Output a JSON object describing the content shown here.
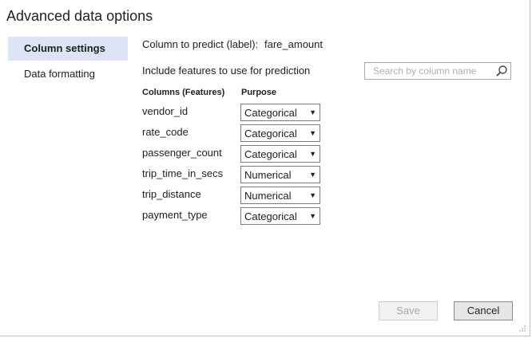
{
  "dialog": {
    "title": "Advanced data options"
  },
  "sidebar": {
    "items": [
      {
        "label": "Column settings",
        "active": true
      },
      {
        "label": "Data formatting",
        "active": false
      }
    ]
  },
  "main": {
    "predict_label": "Column to predict (label):",
    "predict_value": "fare_amount",
    "include_label": "Include features to use for prediction",
    "search": {
      "placeholder": "Search by column name",
      "value": "",
      "icon": "search-icon"
    },
    "headers": {
      "columns": "Columns (Features)",
      "purpose": "Purpose"
    },
    "features": [
      {
        "name": "vendor_id",
        "purpose": "Categorical"
      },
      {
        "name": "rate_code",
        "purpose": "Categorical"
      },
      {
        "name": "passenger_count",
        "purpose": "Categorical"
      },
      {
        "name": "trip_time_in_secs",
        "purpose": "Numerical"
      },
      {
        "name": "trip_distance",
        "purpose": "Numerical"
      },
      {
        "name": "payment_type",
        "purpose": "Categorical"
      }
    ]
  },
  "footer": {
    "save_label": "Save",
    "save_enabled": false,
    "cancel_label": "Cancel"
  },
  "colors": {
    "active_nav_bg": "#dce4f6",
    "disabled_text": "#a8a8a8"
  }
}
